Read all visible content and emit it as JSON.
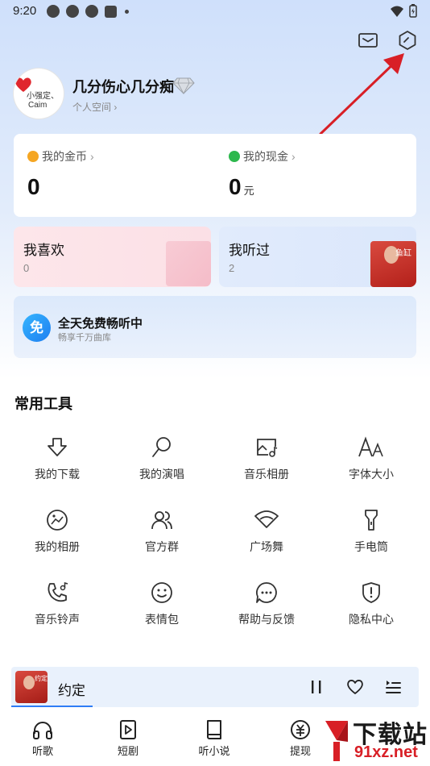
{
  "status_bar": {
    "time": "9:20"
  },
  "profile": {
    "avatar_line1": "小强定、",
    "avatar_line2": "Caim",
    "name": "几分伤心几分痴",
    "space_link": "个人空间 ›"
  },
  "wallet": {
    "coins_label": "我的金币",
    "coins_value": "0",
    "cash_label": "我的现金",
    "cash_value": "0",
    "cash_unit": "元",
    "coin_color": "#f5a623",
    "cash_color": "#2db84d"
  },
  "cards": {
    "like_title": "我喜欢",
    "like_count": "0",
    "heard_title": "我听过",
    "heard_count": "2",
    "heard_cover_text": "鱼缸"
  },
  "free_banner": {
    "icon_text": "免",
    "title": "全天免费畅听中",
    "subtitle": "畅享千万曲库"
  },
  "tools": {
    "title": "常用工具",
    "items": [
      {
        "label": "我的下载",
        "icon": "download-icon"
      },
      {
        "label": "我的演唱",
        "icon": "microphone-icon"
      },
      {
        "label": "音乐相册",
        "icon": "music-album-icon"
      },
      {
        "label": "字体大小",
        "icon": "font-size-icon"
      },
      {
        "label": "我的相册",
        "icon": "photo-album-icon"
      },
      {
        "label": "官方群",
        "icon": "group-icon"
      },
      {
        "label": "广场舞",
        "icon": "fan-dance-icon"
      },
      {
        "label": "手电筒",
        "icon": "flashlight-icon"
      },
      {
        "label": "音乐铃声",
        "icon": "ringtone-icon"
      },
      {
        "label": "表情包",
        "icon": "smile-icon"
      },
      {
        "label": "帮助与反馈",
        "icon": "help-chat-icon"
      },
      {
        "label": "隐私中心",
        "icon": "privacy-shield-icon"
      }
    ]
  },
  "player": {
    "song_title": "约定",
    "cover_text": "约定",
    "progress": 0.2
  },
  "nav": {
    "items": [
      {
        "label": "听歌",
        "icon": "headphones-icon"
      },
      {
        "label": "短剧",
        "icon": "video-play-icon"
      },
      {
        "label": "听小说",
        "icon": "book-icon"
      },
      {
        "label": "提现",
        "icon": "cash-icon"
      }
    ]
  },
  "watermark": {
    "big": "下载站",
    "small": "91xz.net"
  },
  "colors": {
    "accent": "#2f7df6",
    "arrow": "#d81f26"
  }
}
